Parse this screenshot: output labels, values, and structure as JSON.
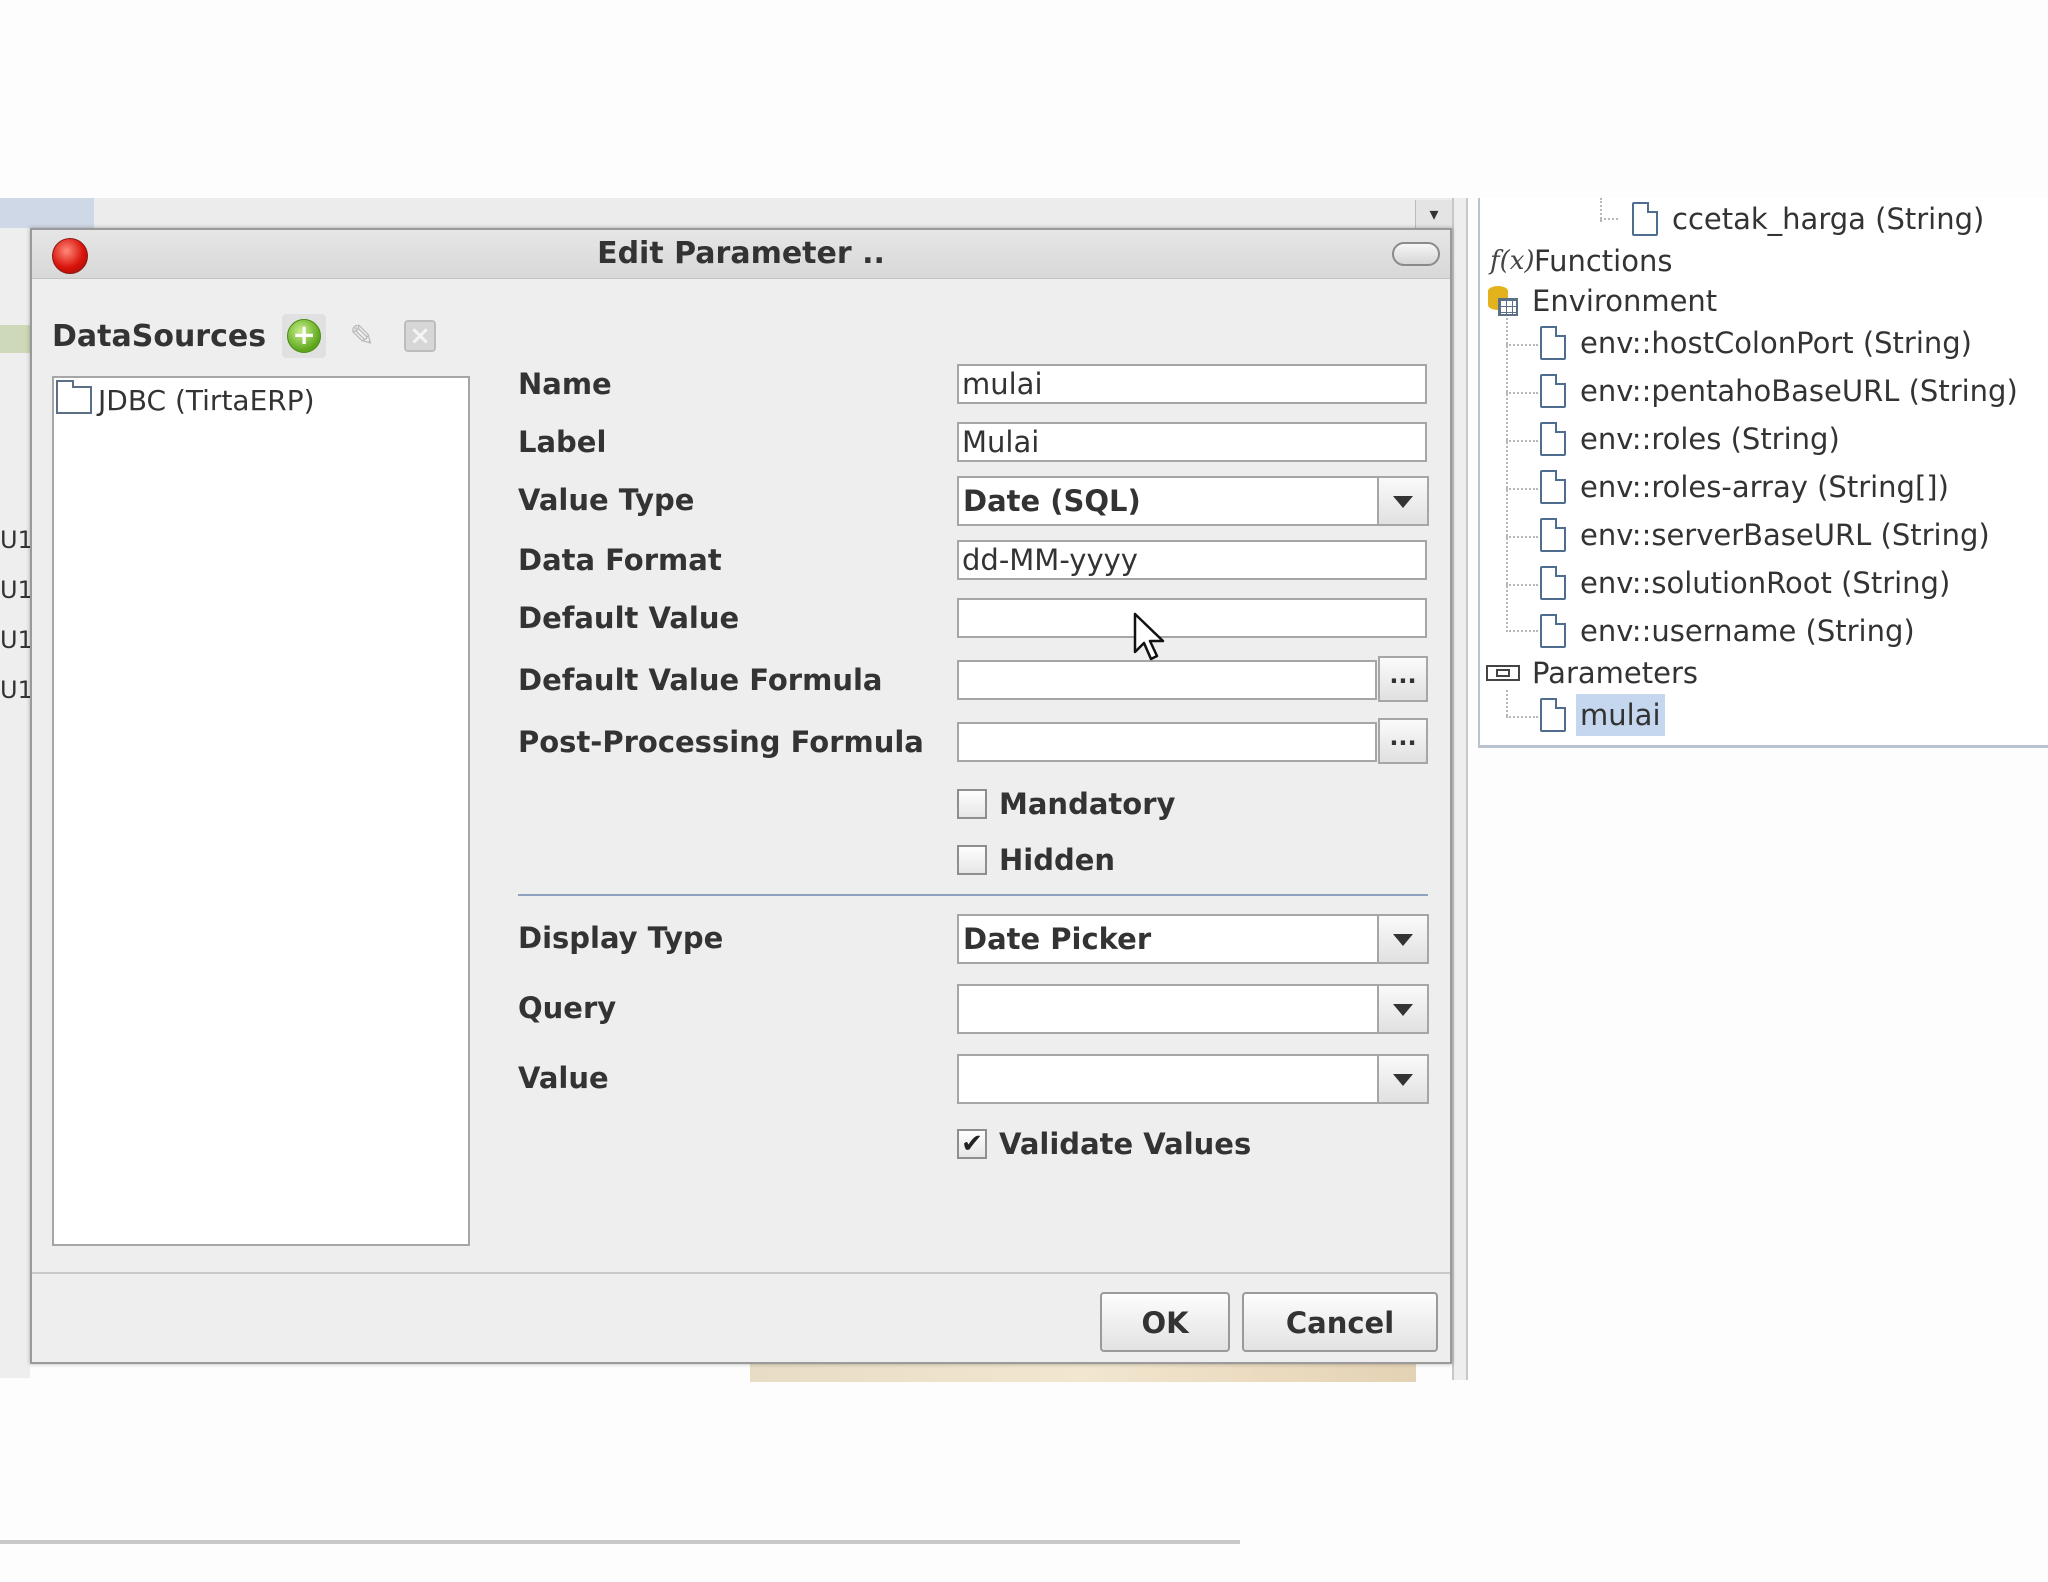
{
  "dialog": {
    "title": "Edit Parameter ..",
    "datasources": {
      "title": "DataSources",
      "items": [
        "JDBC (TirtaERP)"
      ]
    },
    "fields": {
      "name": {
        "label": "Name",
        "value": "mulai"
      },
      "label": {
        "label": "Label",
        "value": "Mulai"
      },
      "value_type": {
        "label": "Value Type",
        "value": "Date (SQL)"
      },
      "data_format": {
        "label": "Data Format",
        "value": "dd-MM-yyyy"
      },
      "default_value": {
        "label": "Default Value",
        "value": ""
      },
      "default_value_formula": {
        "label": "Default Value Formula",
        "value": ""
      },
      "post_processing_formula": {
        "label": "Post-Processing Formula",
        "value": ""
      },
      "mandatory": {
        "label": "Mandatory",
        "checked": false
      },
      "hidden": {
        "label": "Hidden",
        "checked": false
      },
      "display_type": {
        "label": "Display Type",
        "value": "Date Picker"
      },
      "query": {
        "label": "Query",
        "value": ""
      },
      "value": {
        "label": "Value",
        "value": ""
      },
      "validate_values": {
        "label": "Validate Values",
        "checked": true
      }
    },
    "ellipsis_label": "...",
    "check_mark": "✔",
    "ok_label": "OK",
    "cancel_label": "Cancel"
  },
  "tree": {
    "items": [
      {
        "label": "ccetak_harga (String)",
        "icon": "document-icon"
      },
      {
        "label": "Functions",
        "icon": "function-icon"
      },
      {
        "label": "Environment",
        "icon": "environment-icon"
      },
      {
        "label": "env::hostColonPort (String)",
        "icon": "document-icon"
      },
      {
        "label": "env::pentahoBaseURL (String)",
        "icon": "document-icon"
      },
      {
        "label": "env::roles (String)",
        "icon": "document-icon"
      },
      {
        "label": "env::roles-array (String[])",
        "icon": "document-icon"
      },
      {
        "label": "env::serverBaseURL (String)",
        "icon": "document-icon"
      },
      {
        "label": "env::solutionRoot (String)",
        "icon": "document-icon"
      },
      {
        "label": "env::username (String)",
        "icon": "document-icon"
      },
      {
        "label": "Parameters",
        "icon": "parameters-icon"
      },
      {
        "label": "mulai",
        "icon": "document-icon",
        "selected": true
      }
    ]
  },
  "background": {
    "left_fragments": [
      "U1",
      "U1",
      "U1",
      "U1"
    ],
    "scroll_arrow": "▾"
  },
  "colors": {
    "accent_selection": "#c4d7ee",
    "separator": "#8ea2bd",
    "close_button": "#d9140c",
    "add_button": "#5ba51a"
  }
}
